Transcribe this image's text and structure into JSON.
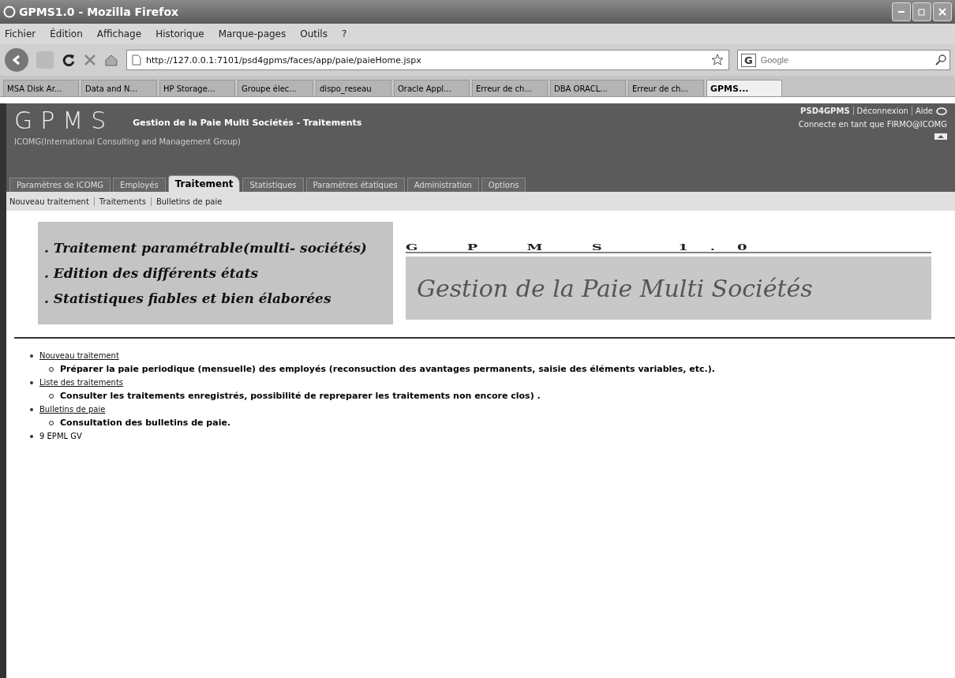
{
  "window": {
    "title": "GPMS1.0 - Mozilla Firefox"
  },
  "menu": [
    "Fichier",
    "Édition",
    "Affichage",
    "Historique",
    "Marque-pages",
    "Outils",
    "?"
  ],
  "address": {
    "value": "http://127.0.0.1:7101/psd4gpms/faces/app/paie/paieHome.jspx"
  },
  "search": {
    "engine": "G",
    "placeholder": "Google"
  },
  "browser_tabs": [
    {
      "label": "MSA Disk Ar...",
      "selected": false
    },
    {
      "label": "Data and N...",
      "selected": false
    },
    {
      "label": "HP Storage...",
      "selected": false
    },
    {
      "label": "Groupe élec...",
      "selected": false
    },
    {
      "label": "dispo_reseau",
      "selected": false
    },
    {
      "label": "Oracle Appl...",
      "selected": false
    },
    {
      "label": "Erreur de ch...",
      "selected": false
    },
    {
      "label": "DBA ORACL...",
      "selected": false
    },
    {
      "label": "Erreur de ch...",
      "selected": false
    },
    {
      "label": "GPMS...",
      "selected": true
    }
  ],
  "app_header": {
    "logo": "GPMS",
    "title": "Gestion de la Paie Multi Sociétés - Traitements",
    "organization": "ICOMG(International Consulting and Management Group)",
    "user_links": [
      "PSD4GPMS",
      "Déconnexion",
      "Aide"
    ],
    "login_status": "Connecte en tant que FIRMO@ICOMG"
  },
  "tabs": [
    {
      "label": "Paramètres de ICOMG",
      "selected": false
    },
    {
      "label": "Employés",
      "selected": false
    },
    {
      "label": "Traitement",
      "selected": true
    },
    {
      "label": "Statistiques",
      "selected": false
    },
    {
      "label": "Paramètres étatiques",
      "selected": false
    },
    {
      "label": "Administration",
      "selected": false
    },
    {
      "label": "Options",
      "selected": false
    }
  ],
  "subnav": [
    "Nouveau traitement",
    "Traitements",
    "Bulletins de paie"
  ],
  "banner": {
    "features": [
      ". Traitement paramétrable(multi- sociétés)",
      ". Edition des différents états",
      ". Statistiques fiables et bien élaborées"
    ],
    "product": "G P M S  1.0",
    "tagline": "Gestion de la Paie Multi Sociétés"
  },
  "items": [
    {
      "kind": "link",
      "label": "Nouveau traitement",
      "detail": "Préparer la paie periodique (mensuelle) des employés (reconsuction des avantages permanents, saisie des éléments variables, etc.)."
    },
    {
      "kind": "link",
      "label": "Liste des traitements",
      "detail": "Consulter les traitements enregistrés, possibilité de repreparer les traitements non encore clos) ."
    },
    {
      "kind": "link",
      "label": "Bulletins de paie",
      "detail": "Consultation des bulletins de paie."
    },
    {
      "kind": "text",
      "label": "9 EPML GV"
    }
  ]
}
